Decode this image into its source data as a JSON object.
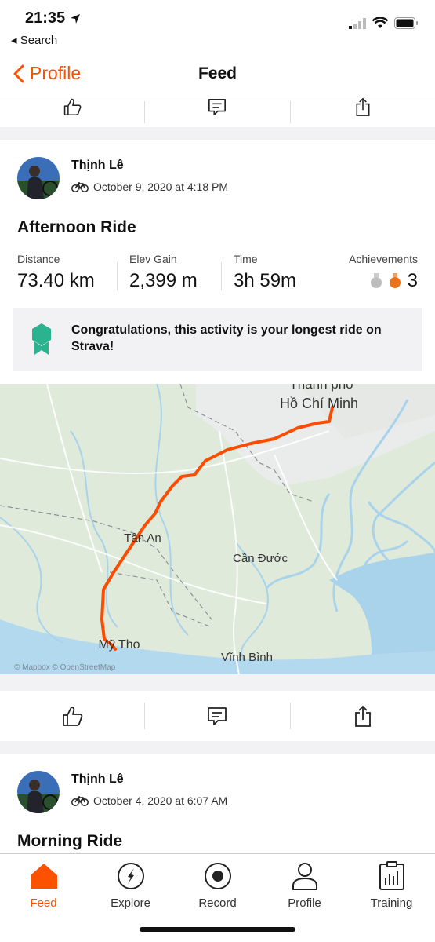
{
  "status_bar": {
    "time": "21:35",
    "back_label": "◂ Search"
  },
  "nav": {
    "back_label": "Profile",
    "title": "Feed"
  },
  "activities": [
    {
      "athlete": "Thịnh Lê",
      "date": "October 9, 2020 at 4:18 PM",
      "title": "Afternoon Ride",
      "stats": {
        "distance_label": "Distance",
        "distance_value": "73.40 km",
        "elev_label": "Elev Gain",
        "elev_value": "2,399 m",
        "time_label": "Time",
        "time_value": "3h 59m",
        "achievements_label": "Achievements",
        "achievements_value": "3"
      },
      "congrats": "Congratulations, this activity is your longest ride on Strava!",
      "map": {
        "labels": [
          "Thành phố",
          "Hồ Chí Minh",
          "Tân An",
          "Cần Đước",
          "Mỹ Tho",
          "Vĩnh Bình"
        ],
        "attribution": "© Mapbox © OpenStreetMap"
      }
    },
    {
      "athlete": "Thịnh Lê",
      "date": "October 4, 2020 at 6:07 AM",
      "title": "Morning Ride"
    }
  ],
  "tabs": [
    {
      "label": "Feed",
      "icon": "home-icon",
      "active": true
    },
    {
      "label": "Explore",
      "icon": "compass-icon"
    },
    {
      "label": "Record",
      "icon": "record-icon"
    },
    {
      "label": "Profile",
      "icon": "profile-icon"
    },
    {
      "label": "Training",
      "icon": "training-icon"
    }
  ],
  "colors": {
    "accent": "#fc5200",
    "medal_silver": "#bdbdbd",
    "medal_orange": "#e8731c",
    "badge_green": "#2bb38f"
  }
}
